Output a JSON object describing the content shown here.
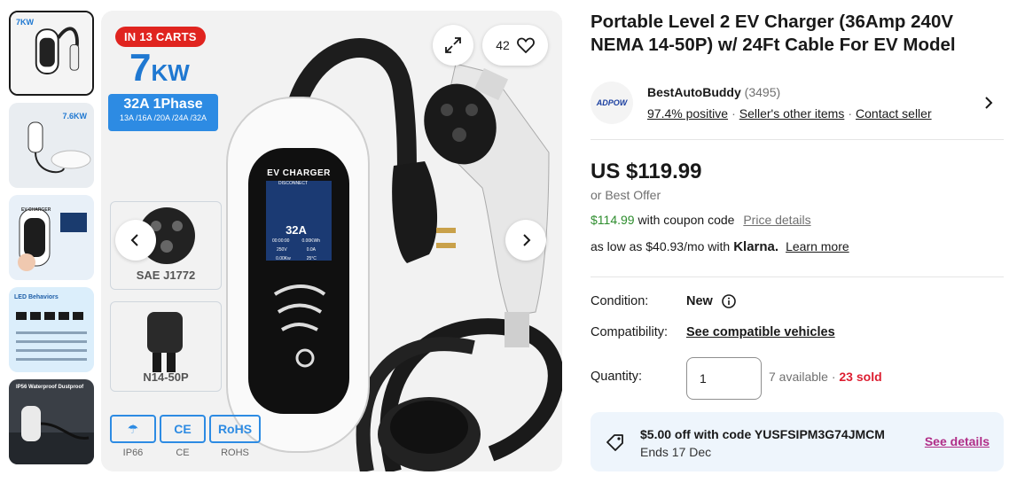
{
  "gallery": {
    "thumbnails": [
      {
        "label": "7KW"
      },
      {
        "label": "7.6KW"
      },
      {
        "label": "EV CHARGER"
      },
      {
        "label": "LED Behaviors"
      },
      {
        "label": "IP56 Waterproof Dustproof"
      }
    ],
    "badge": "IN 13 CARTS",
    "power_value": "7",
    "power_unit": "KW",
    "phase_title": "32A 1Phase",
    "phase_options": "13A /16A /20A /24A /32A",
    "connector_label": "SAE J1772",
    "plug_label": "N14-50P",
    "charger_header": "EV CHARGER",
    "screen_top": "DISCONNECT",
    "screen_amps": "32A",
    "screen_row1": [
      "00:00:00",
      "0.00KWh"
    ],
    "screen_row2": [
      "250V",
      "0.0A"
    ],
    "screen_row3": [
      "0.00Kw",
      "25°C"
    ],
    "certs": [
      {
        "mark": "☂",
        "caption": "IP66"
      },
      {
        "mark": "CE",
        "caption": "CE"
      },
      {
        "mark": "RoHS",
        "caption": "ROHS"
      }
    ],
    "watch_count": "42"
  },
  "product": {
    "title": "Portable Level 2 EV Charger (36Amp 240V NEMA 14-50P) w/ 24Ft Cable For EV Model",
    "seller": {
      "logo_text": "ADPOW",
      "name": "BestAutoBuddy",
      "feedback_count": "(3495)",
      "positive": "97.4% positive",
      "other_items": "Seller's other items",
      "contact": "Contact seller"
    },
    "price": "US $119.99",
    "best_offer": "or Best Offer",
    "coupon_price": "$114.99",
    "coupon_text": "with coupon code",
    "price_details": "Price details",
    "klarna_prefix": "as low as $40.93/mo with",
    "klarna_brand": "Klarna.",
    "learn_more": "Learn more",
    "condition_label": "Condition:",
    "condition_value": "New",
    "compat_label": "Compatibility:",
    "compat_value": "See compatible vehicles",
    "quantity_label": "Quantity:",
    "quantity_value": "1",
    "available": "7 available",
    "sold": "23 sold",
    "promo_title": "$5.00 off with code YUSFSIPM3G74JMCM",
    "promo_ends": "Ends 17 Dec",
    "promo_link": "See details"
  },
  "colors": {
    "accent_blue": "#2d8be3",
    "badge_red": "#e0241f",
    "sold_red": "#dd1e31",
    "coupon_green": "#2e8d2e",
    "link_purple": "#b02d87"
  }
}
